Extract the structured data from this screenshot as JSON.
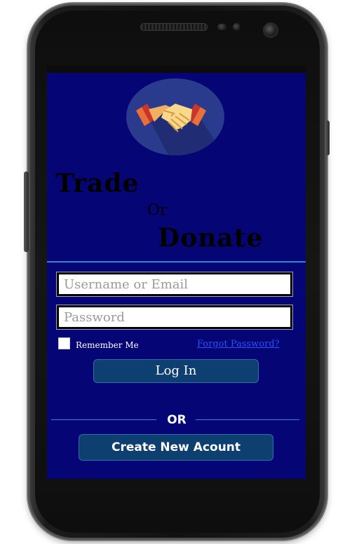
{
  "app": {
    "brand": {
      "line1": "Trade",
      "line2": "Or",
      "line3": "Donate"
    }
  },
  "login_form": {
    "username_placeholder": "Username or Email",
    "username_value": "",
    "password_placeholder": "Password",
    "password_value": "",
    "remember_label": "Remember Me",
    "remember_checked": false,
    "forgot_label": "Forgot Password?",
    "login_label": "Log In"
  },
  "alternate": {
    "or_label": "OR",
    "create_label": "Create New Acount"
  },
  "icons": {
    "logo": "handshake-icon"
  },
  "colors": {
    "screen_background": "#050575",
    "button_background": "#0d3f71",
    "divider": "#2e84d6",
    "link": "#2a50ff",
    "logo_circle": "#2a3a8c"
  }
}
